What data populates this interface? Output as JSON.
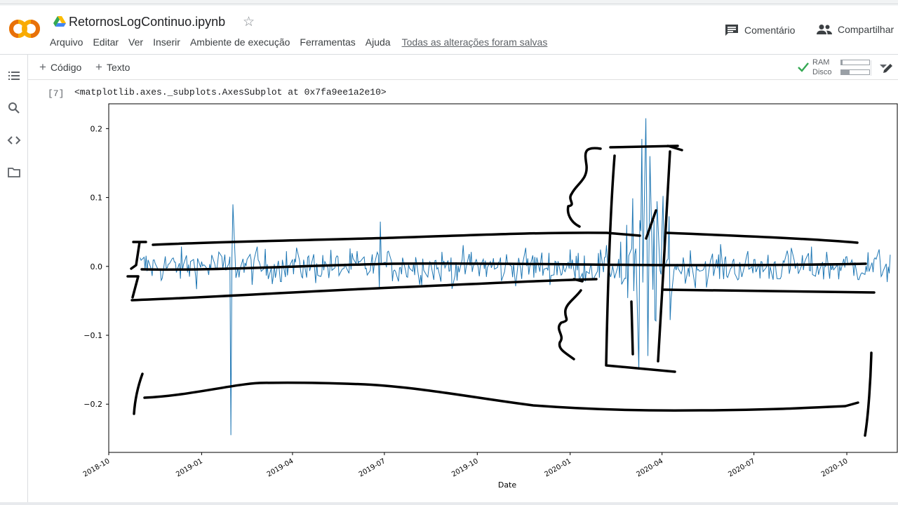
{
  "header": {
    "file_name": "RetornosLogContinuo.ipynb",
    "menu": [
      "Arquivo",
      "Editar",
      "Ver",
      "Inserir",
      "Ambiente de execução",
      "Ferramentas",
      "Ajuda"
    ],
    "saved_status": "Todas as alterações foram salvas",
    "comment_label": "Comentário",
    "share_label": "Compartilhar"
  },
  "toolbar": {
    "add_code_label": "Código",
    "add_text_label": "Texto",
    "ram_label": "RAM",
    "disk_label": "Disco",
    "ram_usage": 0.05,
    "disk_usage": 0.3
  },
  "cell": {
    "exec_count": "[7]",
    "output_text": "<matplotlib.axes._subplots.AxesSubplot at 0x7fa9ee1a2e10>"
  },
  "colors": {
    "series": "#1f77b4",
    "colab_orange": "#F9AB00",
    "check_green": "#34a853",
    "ink": "#000000"
  },
  "chart_data": {
    "type": "line",
    "xlabel": "Date",
    "x_ticks": [
      "2018-10",
      "2019-01",
      "2019-04",
      "2019-07",
      "2019-10",
      "2020-01",
      "2020-04",
      "2020-07",
      "2020-10"
    ],
    "y_ticks": [
      "0.2",
      "0.1",
      "0.0",
      "−0.1",
      "−0.2"
    ],
    "xlim": [
      "2018-10-01",
      "2020-11-20"
    ],
    "ylim": [
      -0.27,
      0.236
    ],
    "spikes": [
      {
        "date": "2019-01-30",
        "value": -0.245
      },
      {
        "date": "2019-02-01",
        "value": 0.09
      },
      {
        "date": "2019-06-27",
        "value": 0.065
      },
      {
        "date": "2020-03-09",
        "value": -0.15
      },
      {
        "date": "2020-03-12",
        "value": 0.185
      },
      {
        "date": "2020-03-16",
        "value": 0.215
      },
      {
        "date": "2020-03-18",
        "value": -0.13
      },
      {
        "date": "2020-03-20",
        "value": 0.16
      }
    ],
    "series": [
      {
        "noise_base": 0.018,
        "volatile_period": [
          "2020-02-20",
          "2020-04-10"
        ],
        "volatile_scale": 0.07
      }
    ]
  }
}
